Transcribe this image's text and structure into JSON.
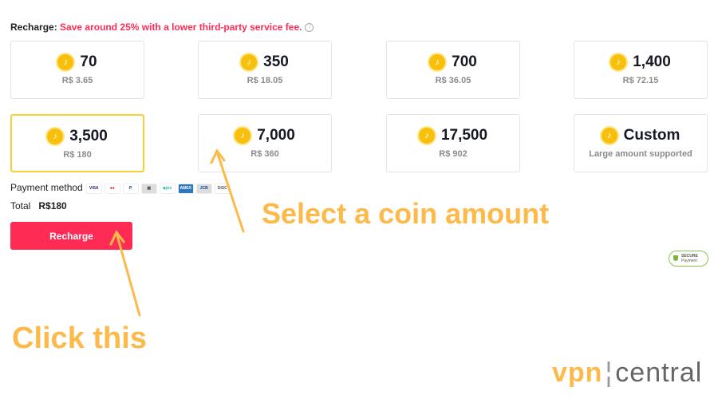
{
  "header": {
    "label": "Recharge:",
    "promo": "Save around 25% with a lower third-party service fee.",
    "info_icon": "info-icon"
  },
  "packages": [
    {
      "coins": "70",
      "price": "R$ 3.65"
    },
    {
      "coins": "350",
      "price": "R$ 18.05"
    },
    {
      "coins": "700",
      "price": "R$ 36.05"
    },
    {
      "coins": "1,400",
      "price": "R$ 72.15"
    },
    {
      "coins": "3,500",
      "price": "R$ 180",
      "selected": true
    },
    {
      "coins": "7,000",
      "price": "R$ 360"
    },
    {
      "coins": "17,500",
      "price": "R$ 902"
    },
    {
      "coins": "Custom",
      "price": "Large amount supported"
    }
  ],
  "payment": {
    "label": "Payment method",
    "methods": [
      "VISA",
      "Mastercard",
      "PayPal",
      "Boleto",
      "Pix",
      "American Express",
      "JCB",
      "Discover"
    ]
  },
  "total": {
    "label": "Total",
    "value": "R$180"
  },
  "recharge_button": "Recharge",
  "secure_badge": {
    "line1": "SECURE",
    "line2": "Payment"
  },
  "annotations": {
    "select": "Select a coin amount",
    "click": "Click this"
  },
  "logo": {
    "part1": "vpn",
    "part2": "central"
  },
  "colors": {
    "accent": "#fe2c55",
    "selected_border": "#f8cf38",
    "annotation": "#fdb94a"
  }
}
